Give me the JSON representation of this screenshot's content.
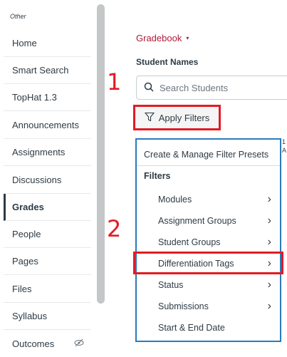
{
  "sidebar": {
    "header": "Other",
    "items": [
      {
        "label": "Home"
      },
      {
        "label": "Smart Search"
      },
      {
        "label": "TopHat 1.3"
      },
      {
        "label": "Announcements"
      },
      {
        "label": "Assignments"
      },
      {
        "label": "Discussions"
      },
      {
        "label": "Grades",
        "active": true
      },
      {
        "label": "People"
      },
      {
        "label": "Pages"
      },
      {
        "label": "Files"
      },
      {
        "label": "Syllabus"
      },
      {
        "label": "Outcomes",
        "icon": "eye-slash-icon"
      }
    ]
  },
  "main": {
    "gradebook_label": "Gradebook",
    "gradebook_caret": "▾",
    "student_names_label": "Student Names",
    "search_placeholder": "Search Students",
    "apply_filters_label": "Apply Filters",
    "peek_text_1": "1",
    "peek_text_2": "A"
  },
  "annotations": {
    "step1": "1",
    "step2": "2",
    "color": "#e31b23"
  },
  "dropdown": {
    "presets_label": "Create & Manage Filter Presets",
    "filters_heading": "Filters",
    "items": [
      {
        "label": "Modules",
        "chevron": true
      },
      {
        "label": "Assignment Groups",
        "chevron": true
      },
      {
        "label": "Student Groups",
        "chevron": true
      },
      {
        "label": "Differentiation Tags",
        "chevron": true,
        "highlighted": true
      },
      {
        "label": "Status",
        "chevron": true
      },
      {
        "label": "Submissions",
        "chevron": true
      },
      {
        "label": "Start & End Date",
        "chevron": false
      }
    ]
  },
  "colors": {
    "accent_link": "#b0193a",
    "dropdown_border": "#2b7abc",
    "annotation": "#e31b23"
  }
}
